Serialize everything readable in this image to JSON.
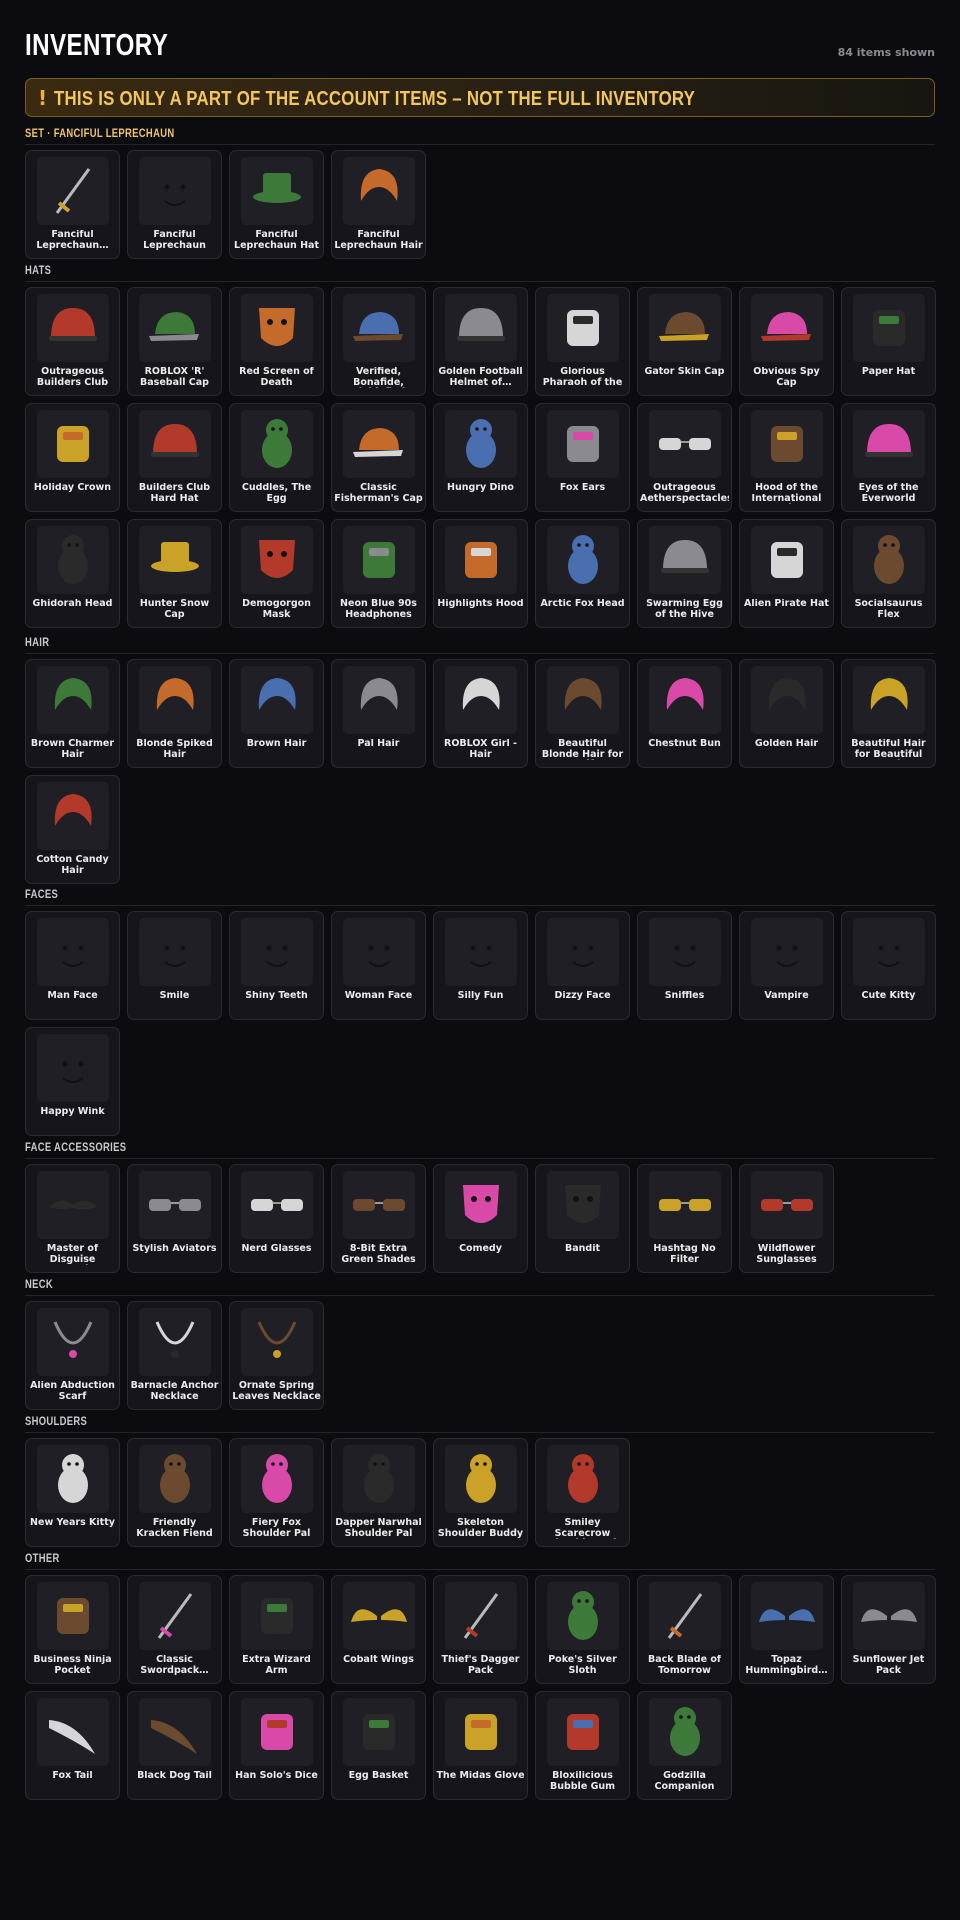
{
  "page": {
    "title": "INVENTORY",
    "count": "84 items shown",
    "warning_icon": "!",
    "warning": "THIS IS ONLY A PART OF THE ACCOUNT ITEMS – NOT THE FULL INVENTORY"
  },
  "sections": [
    {
      "title": "SET · FANCIFUL LEPRECHAUN",
      "accent": true,
      "items": [
        {
          "name": "Fanciful Leprechaun…",
          "icon": "staff-icon"
        },
        {
          "name": "Fanciful Leprechaun Face",
          "icon": "face-icon"
        },
        {
          "name": "Fanciful Leprechaun Hat",
          "icon": "hat-icon"
        },
        {
          "name": "Fanciful Leprechaun Hair",
          "icon": "hair-icon"
        }
      ]
    },
    {
      "title": "HATS",
      "accent": false,
      "items": [
        {
          "name": "Outrageous Builders Club Ha…",
          "icon": "hardhat-icon"
        },
        {
          "name": "ROBLOX 'R' Baseball Cap",
          "icon": "cap-icon"
        },
        {
          "name": "Red Screen of Death",
          "icon": "screen-icon"
        },
        {
          "name": "Verified, Bonafide, Plaidafied",
          "icon": "cap-icon"
        },
        {
          "name": "Golden Football Helmet of…",
          "icon": "helmet-icon"
        },
        {
          "name": "Glorious Pharaoh of the Sun",
          "icon": "pharaoh-icon"
        },
        {
          "name": "Gator Skin Cap",
          "icon": "cap-icon"
        },
        {
          "name": "Obvious Spy Cap",
          "icon": "cap-icon"
        },
        {
          "name": "Paper Hat",
          "icon": "paper-hat-icon"
        },
        {
          "name": "Holiday Crown",
          "icon": "crown-icon"
        },
        {
          "name": "Builders Club Hard Hat",
          "icon": "hardhat-icon"
        },
        {
          "name": "Cuddles, The Egg",
          "icon": "animal-head-icon"
        },
        {
          "name": "Classic Fisherman's Cap",
          "icon": "cap-icon"
        },
        {
          "name": "Hungry Dino",
          "icon": "dino-icon"
        },
        {
          "name": "Fox Ears",
          "icon": "ears-icon"
        },
        {
          "name": "Outrageous Aetherspectacles",
          "icon": "goggles-icon"
        },
        {
          "name": "Hood of the International Ord…",
          "icon": "hood-icon"
        },
        {
          "name": "Eyes of the Everworld",
          "icon": "helmet-icon"
        },
        {
          "name": "Ghidorah Head",
          "icon": "dragon-icon"
        },
        {
          "name": "Hunter Snow Cap",
          "icon": "hat-icon"
        },
        {
          "name": "Demogorgon Mask",
          "icon": "mask-icon"
        },
        {
          "name": "Neon Blue 90s Headphones",
          "icon": "headphones-icon"
        },
        {
          "name": "Highlights Hood",
          "icon": "hood-icon"
        },
        {
          "name": "Arctic Fox Head",
          "icon": "animal-head-icon"
        },
        {
          "name": "Swarming Egg of the Hive",
          "icon": "egg-icon"
        },
        {
          "name": "Alien Pirate Hat",
          "icon": "antenna-icon"
        },
        {
          "name": "Socialsaurus Flex",
          "icon": "dino-icon"
        }
      ]
    },
    {
      "title": "HAIR",
      "accent": false,
      "items": [
        {
          "name": "Brown Charmer Hair",
          "icon": "hair-icon"
        },
        {
          "name": "Blonde Spiked Hair",
          "icon": "hair-icon"
        },
        {
          "name": "Brown Hair",
          "icon": "hair-icon"
        },
        {
          "name": "Pal Hair",
          "icon": "hair-icon"
        },
        {
          "name": "ROBLOX Girl - Hair",
          "icon": "hair-icon"
        },
        {
          "name": "Beautiful Blonde Hair for Beautifu…",
          "icon": "hair-icon"
        },
        {
          "name": "Chestnut Bun",
          "icon": "hair-icon"
        },
        {
          "name": "Golden Hair",
          "icon": "hair-icon"
        },
        {
          "name": "Beautiful Hair for Beautiful People",
          "icon": "hair-icon"
        },
        {
          "name": "Cotton Candy Hair",
          "icon": "hair-icon"
        }
      ]
    },
    {
      "title": "FACES",
      "accent": false,
      "items": [
        {
          "name": "Man Face",
          "icon": "face-icon"
        },
        {
          "name": "Smile",
          "icon": "face-icon"
        },
        {
          "name": "Shiny Teeth",
          "icon": "face-icon"
        },
        {
          "name": "Woman Face",
          "icon": "face-icon"
        },
        {
          "name": "Silly Fun",
          "icon": "face-icon"
        },
        {
          "name": "Dizzy Face",
          "icon": "face-icon"
        },
        {
          "name": "Sniffles",
          "icon": "face-icon"
        },
        {
          "name": "Vampire",
          "icon": "face-icon"
        },
        {
          "name": "Cute Kitty",
          "icon": "face-icon"
        },
        {
          "name": "Happy Wink",
          "icon": "face-icon"
        }
      ]
    },
    {
      "title": "FACE ACCESSORIES",
      "accent": false,
      "items": [
        {
          "name": "Master of Disguise Mustache",
          "icon": "mustache-icon"
        },
        {
          "name": "Stylish Aviators",
          "icon": "glasses-icon"
        },
        {
          "name": "Nerd Glasses",
          "icon": "glasses-icon"
        },
        {
          "name": "8-Bit Extra Green Shades",
          "icon": "glasses-icon"
        },
        {
          "name": "Comedy",
          "icon": "mask-icon"
        },
        {
          "name": "Bandit",
          "icon": "bandana-icon"
        },
        {
          "name": "Hashtag No Filter",
          "icon": "glasses-icon"
        },
        {
          "name": "Wildflower Sunglasses",
          "icon": "glasses-icon"
        }
      ]
    },
    {
      "title": "NECK",
      "accent": false,
      "items": [
        {
          "name": "Alien Abduction Scarf",
          "icon": "scarf-icon"
        },
        {
          "name": "Barnacle Anchor Necklace",
          "icon": "necklace-icon"
        },
        {
          "name": "Ornate Spring Leaves Necklace",
          "icon": "necklace-icon"
        }
      ]
    },
    {
      "title": "SHOULDERS",
      "accent": false,
      "items": [
        {
          "name": "New Years Kitty",
          "icon": "pet-icon"
        },
        {
          "name": "Friendly Kracken Fiend",
          "icon": "pet-icon"
        },
        {
          "name": "Fiery Fox Shoulder Pal",
          "icon": "pet-icon"
        },
        {
          "name": "Dapper Narwhal Shoulder Pal",
          "icon": "pet-icon"
        },
        {
          "name": "Skeleton Shoulder Buddy",
          "icon": "pet-icon"
        },
        {
          "name": "Smiley Scarecrow Shoulder Pal",
          "icon": "pet-icon"
        }
      ]
    },
    {
      "title": "OTHER",
      "accent": false,
      "items": [
        {
          "name": "Business Ninja Pocket",
          "icon": "pocket-icon"
        },
        {
          "name": "Classic Swordpack…",
          "icon": "swords-icon"
        },
        {
          "name": "Extra Wizard Arm",
          "icon": "arm-icon"
        },
        {
          "name": "Cobalt Wings",
          "icon": "wings-icon"
        },
        {
          "name": "Thief's Dagger Pack",
          "icon": "dagger-icon"
        },
        {
          "name": "Poke's Silver Sloth",
          "icon": "pet-icon"
        },
        {
          "name": "Back Blade of Tomorrow",
          "icon": "sword-icon"
        },
        {
          "name": "Topaz Hummingbird…",
          "icon": "wings-icon"
        },
        {
          "name": "Sunflower Jet Pack",
          "icon": "wings-icon"
        },
        {
          "name": "Fox Tail",
          "icon": "tail-icon"
        },
        {
          "name": "Black Dog Tail",
          "icon": "tail-icon"
        },
        {
          "name": "Han Solo's Dice",
          "icon": "dice-icon"
        },
        {
          "name": "Egg Basket",
          "icon": "basket-icon"
        },
        {
          "name": "The Midas Glove",
          "icon": "glove-icon"
        },
        {
          "name": "Bloxilicious Bubble Gum",
          "icon": "gum-icon"
        },
        {
          "name": "Godzilla Companion",
          "icon": "pet-icon"
        }
      ]
    }
  ]
}
